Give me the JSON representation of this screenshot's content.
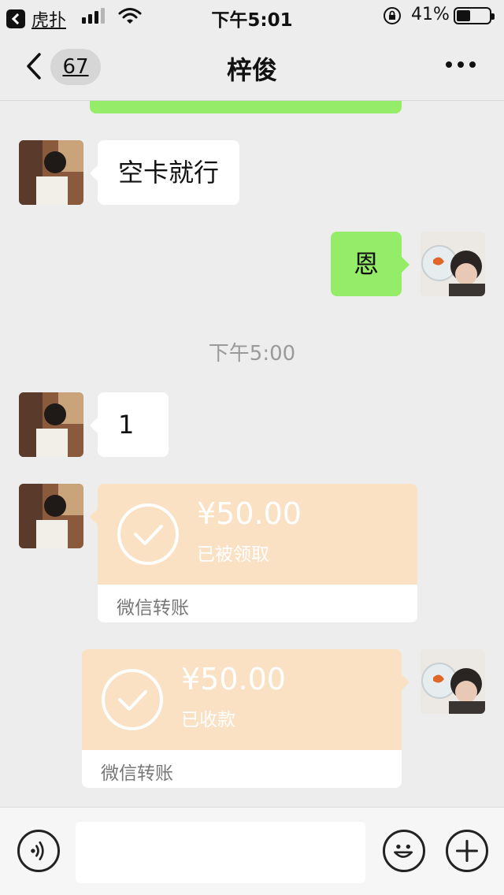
{
  "status_bar": {
    "back_app_label": "虎扑",
    "time": "下午5:01",
    "battery_percent": "41%",
    "battery_level": 0.41,
    "signal_bars": 3,
    "lock_icon": "rotation-lock-icon",
    "wifi_icon": "wifi-icon"
  },
  "nav": {
    "back_icon": "chevron-left-icon",
    "unread_count": "67",
    "title": "梓俊",
    "more_icon": "more-dots-icon"
  },
  "messages": [
    {
      "sender": "contact",
      "type": "text",
      "text": "空卡就行"
    },
    {
      "sender": "me",
      "type": "text",
      "text": "恩"
    },
    {
      "type": "time",
      "text": "下午5:00"
    },
    {
      "sender": "contact",
      "type": "text",
      "text": "1"
    },
    {
      "sender": "contact",
      "type": "transfer",
      "amount": "¥50.00",
      "status": "已被领取",
      "label": "微信转账"
    },
    {
      "sender": "me",
      "type": "transfer",
      "amount": "¥50.00",
      "status": "已收款",
      "label": "微信转账"
    }
  ],
  "input_bar": {
    "voice_icon": "voice-icon",
    "placeholder": "",
    "emoji_icon": "emoji-icon",
    "plus_icon": "plus-icon"
  },
  "colors": {
    "background": "#ededed",
    "my_bubble": "#95ec69",
    "their_bubble": "#ffffff",
    "transfer_card": "#fbe1c4"
  }
}
